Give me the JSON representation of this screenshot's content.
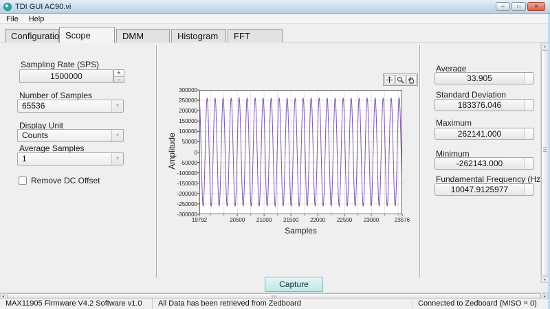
{
  "window": {
    "title": "TDI GUI AC90.vi"
  },
  "menu": {
    "file": "File",
    "help": "Help"
  },
  "tabs": {
    "configuration": "Configuration",
    "scope": "Scope",
    "dmm": "DMM",
    "histogram": "Histogram",
    "fft": "FFT",
    "active_tab": "Scope"
  },
  "controls": {
    "sampling_rate_label": "Sampling Rate (SPS)",
    "sampling_rate_value": "1500000",
    "number_of_samples_label": "Number of Samples",
    "number_of_samples_value": "65536",
    "display_unit_label": "Display Unit",
    "display_unit_value": "Counts",
    "average_samples_label": "Average Samples",
    "average_samples_value": "1",
    "remove_dc_offset_label": "Remove DC Offset",
    "remove_dc_offset_checked": false
  },
  "stats": {
    "average_label": "Average",
    "average_value": "33.905",
    "std_label": "Standard Deviation",
    "std_value": "183376.046",
    "max_label": "Maximum",
    "max_value": "262141.000",
    "min_label": "Minimum",
    "min_value": "-262143.000",
    "fund_label": "Fundamental Frequency (Hz)",
    "fund_value": "10047.9125977"
  },
  "chart_data": {
    "type": "line",
    "title": "",
    "xlabel": "Samples",
    "ylabel": "Amplitude",
    "xlim": [
      19792,
      23576
    ],
    "ylim": [
      -300000,
      300000
    ],
    "x_tick_labels": [
      19792,
      20500,
      21000,
      21500,
      22000,
      22500,
      23000,
      23576
    ],
    "y_tick_labels": [
      300000,
      250000,
      200000,
      150000,
      100000,
      50000,
      0,
      -50000,
      -100000,
      -150000,
      -200000,
      -250000,
      -300000
    ],
    "x_grid_step": 250,
    "grid": true,
    "legend": "none",
    "series": [
      {
        "name": "scope-waveform",
        "waveform": "sine",
        "color": "#7e57a7",
        "amplitude": 262142,
        "dc_offset": 33.905,
        "frequency_hz": 10047.9125977,
        "sampling_rate_sps": 1500000,
        "phase_rad": 1.75
      }
    ],
    "stats": {
      "average": 33.905,
      "std_dev": 183376.046,
      "max": 262141.0,
      "min": -262143.0,
      "fundamental_hz": 10047.9125977
    }
  },
  "capture": {
    "label": "Capture"
  },
  "statusbar": {
    "left": "MAX11905 Firmware V4.2 Software v1.0",
    "center": "All Data has been retrieved from Zedboard",
    "right": "Connected to Zedboard (MISO = 0)"
  },
  "icons": {
    "minimize": "–",
    "maximize": "□",
    "close": "×",
    "combo_arrow": "▼",
    "spinner_up": "+",
    "spinner_down": "-",
    "scroll_left": "◄",
    "scroll_right": "►",
    "scroll_up": "▲",
    "scroll_down": "▼"
  },
  "colors": {
    "titlebar": "#bdd2e6",
    "panel": "#efefef",
    "waveform": "#7e57a7",
    "capture_button": "#c9ebe9",
    "close_button": "#d2664c",
    "window_edge": "#bcdcf4"
  }
}
